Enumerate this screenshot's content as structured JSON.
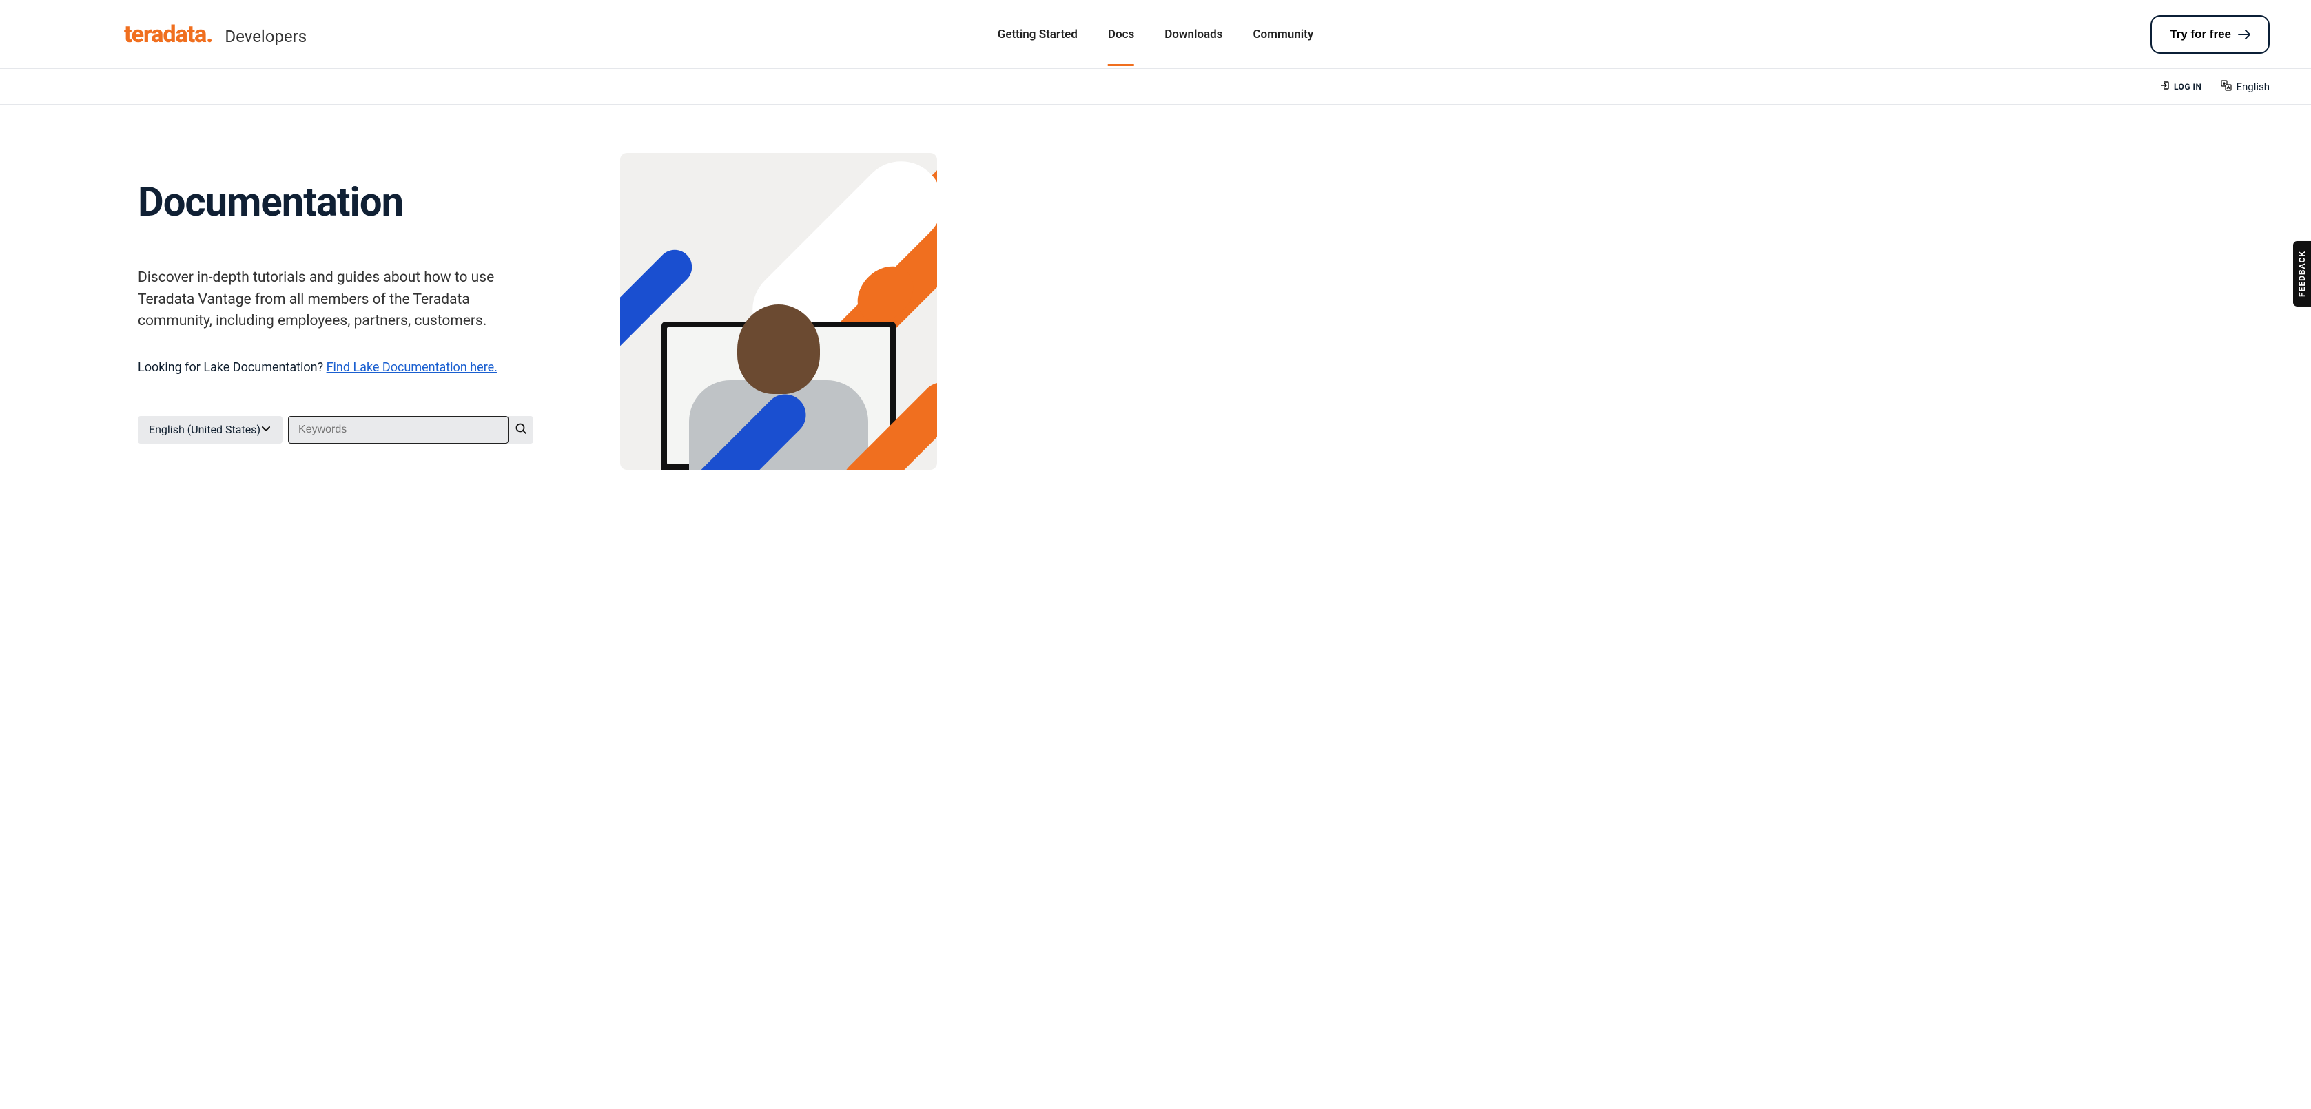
{
  "brand": {
    "logo": "teradata.",
    "sub": "Developers"
  },
  "nav": {
    "items": [
      {
        "label": "Getting Started",
        "active": false
      },
      {
        "label": "Docs",
        "active": true
      },
      {
        "label": "Downloads",
        "active": false
      },
      {
        "label": "Community",
        "active": false
      }
    ],
    "try_for_free": "Try for free"
  },
  "utility": {
    "log_in": "LOG IN",
    "language": "English"
  },
  "hero": {
    "title": "Documentation",
    "description": "Discover in-depth tutorials and guides about how to use Teradata Vantage from all members of the Teradata community, including employees, partners, customers.",
    "lake_prompt": "Looking for Lake Documentation? ",
    "lake_link": "Find Lake Documentation here."
  },
  "search": {
    "language_selected": "English (United States)",
    "placeholder": "Keywords",
    "value": ""
  },
  "feedback": {
    "label": "FEEDBACK"
  }
}
